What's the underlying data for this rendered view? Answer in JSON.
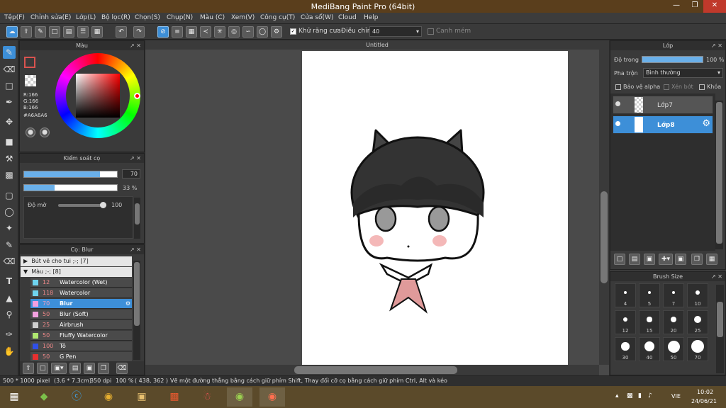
{
  "window": {
    "title": "MediBang Paint Pro (64bit)"
  },
  "menu": [
    "Tệp(F)",
    "Chỉnh sửa(E)",
    "Lớp(L)",
    "Bộ lọc(R)",
    "Chọn(S)",
    "Chụp(N)",
    "Màu (C)",
    "Xem(V)",
    "Công cụ(T)",
    "Cửa sổ(W)",
    "Cloud",
    "Help"
  ],
  "toolbar": {
    "antialias_label": "Khử răng cưa",
    "adjust_label": "Điều chỉnh",
    "adjust_value": "40",
    "snap_label": "Canh mém"
  },
  "color_panel": {
    "title": "Màu",
    "r": "R:166",
    "g": "G:166",
    "b": "B:166",
    "hex": "#A6A6A6",
    "primary_color": "#d9534f",
    "secondary_color": "#a0b8e8"
  },
  "brush_control": {
    "title": "Kiểm soát cọ",
    "size_value": "70",
    "size_fraction": 0.82,
    "opacity_value": "33 %",
    "opacity_fraction": 0.33,
    "blur_label": "Độ mờ",
    "blur_value": "100",
    "blur_fraction": 1.0
  },
  "brush_list": {
    "title": "Cọ: Blur",
    "groups": [
      {
        "label": "Bút vẽ cho tui ;-; [7]",
        "expanded": false
      },
      {
        "label": "Màu ;-; [8]",
        "expanded": true
      }
    ],
    "items": [
      {
        "size": "12",
        "name": "Watercolor (Wet)",
        "color": "#6fd4ef",
        "selected": false
      },
      {
        "size": "118",
        "name": "Watercolor",
        "color": "#6fd4ef",
        "selected": false
      },
      {
        "size": "70",
        "name": "Blur",
        "color": "#f3a0e0",
        "selected": true
      },
      {
        "size": "50",
        "name": "Blur (Soft)",
        "color": "#f3a0e0",
        "selected": false
      },
      {
        "size": "25",
        "name": "Airbrush",
        "color": "#d0d0d0",
        "selected": false
      },
      {
        "size": "50",
        "name": "Fluffy Watercolor",
        "color": "#b0e870",
        "selected": false
      },
      {
        "size": "100",
        "name": "Tô",
        "color": "#3050e8",
        "selected": false
      },
      {
        "size": "50",
        "name": "G Pen",
        "color": "#e83030",
        "selected": false
      }
    ]
  },
  "canvas": {
    "tab_title": "Untitled"
  },
  "layer_panel": {
    "title": "Lớp",
    "opacity_label": "Độ trong",
    "opacity_value": "100 %",
    "opacity_fraction": 1.0,
    "blend_label": "Pha trộn",
    "blend_value": "Bình thường",
    "alpha_label": "Bảo vệ alpha",
    "clip_label": "Xén bớt",
    "lock_label": "Khóa",
    "layers": [
      {
        "name": "Lớp7",
        "selected": false
      },
      {
        "name": "Lớp8",
        "selected": true
      }
    ]
  },
  "brush_size_panel": {
    "title": "Brush Size",
    "sizes": [
      "4",
      "5",
      "7",
      "10",
      "12",
      "15",
      "20",
      "25",
      "30",
      "40",
      "50",
      "70"
    ]
  },
  "status": {
    "dims": "500 * 1000 pixel",
    "cm": "(3.6 * 7.3cm)",
    "dpi": "350 dpi",
    "zoom": "100 %",
    "coords": "( 438, 362 )",
    "hint": "Vẽ một đường thẳng bằng cách giữ phím Shift, Thay đổi cỡ cọ bằng cách giữ phím Ctrl, Alt và kéo"
  },
  "taskbar": {
    "lang": "VIE",
    "time": "10:02",
    "date": "24/06/21"
  }
}
